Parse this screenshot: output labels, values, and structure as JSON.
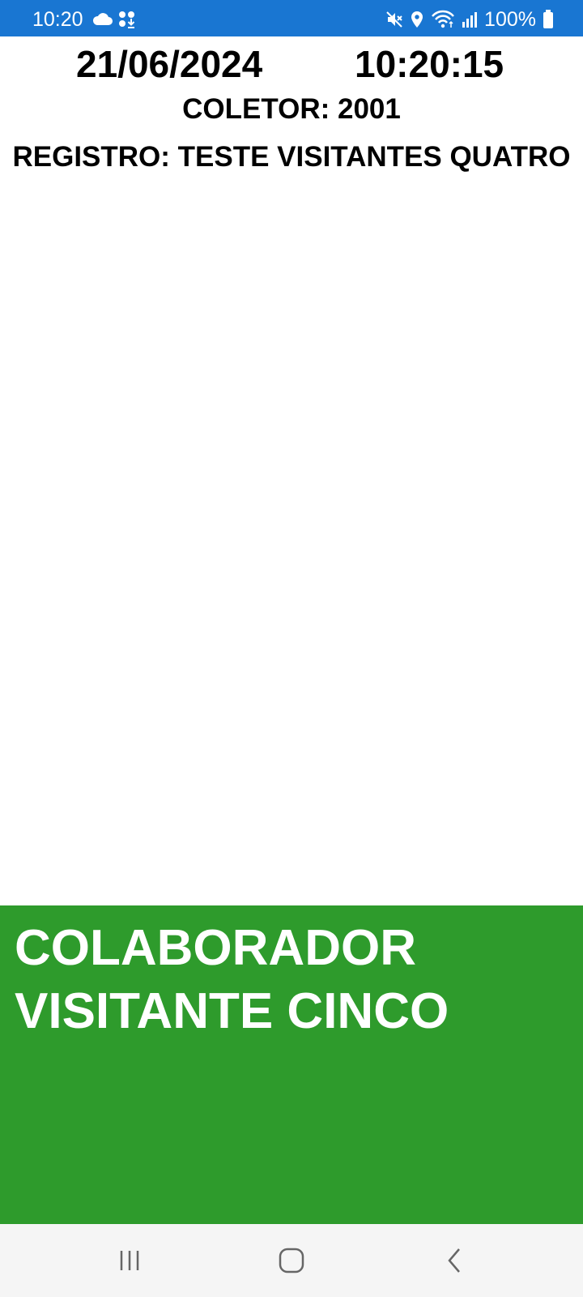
{
  "status_bar": {
    "time": "10:20",
    "battery": "100%",
    "icons_left": [
      "cloud-icon",
      "download-app-icon"
    ],
    "icons_right": [
      "mute-icon",
      "location-icon",
      "wifi-icon",
      "signal-icon",
      "battery-icon"
    ],
    "background_color": "#1976d2"
  },
  "header": {
    "date": "21/06/2024",
    "time": "10:20:15",
    "collector": "COLETOR: 2001",
    "registry": "REGISTRO: TESTE VISITANTES QUATRO"
  },
  "result": {
    "name": "COLABORADOR VISITANTE CINCO",
    "background_color": "#2e9b2c"
  },
  "nav_bar": {
    "buttons": [
      "recents-icon",
      "home-icon",
      "back-icon"
    ]
  }
}
